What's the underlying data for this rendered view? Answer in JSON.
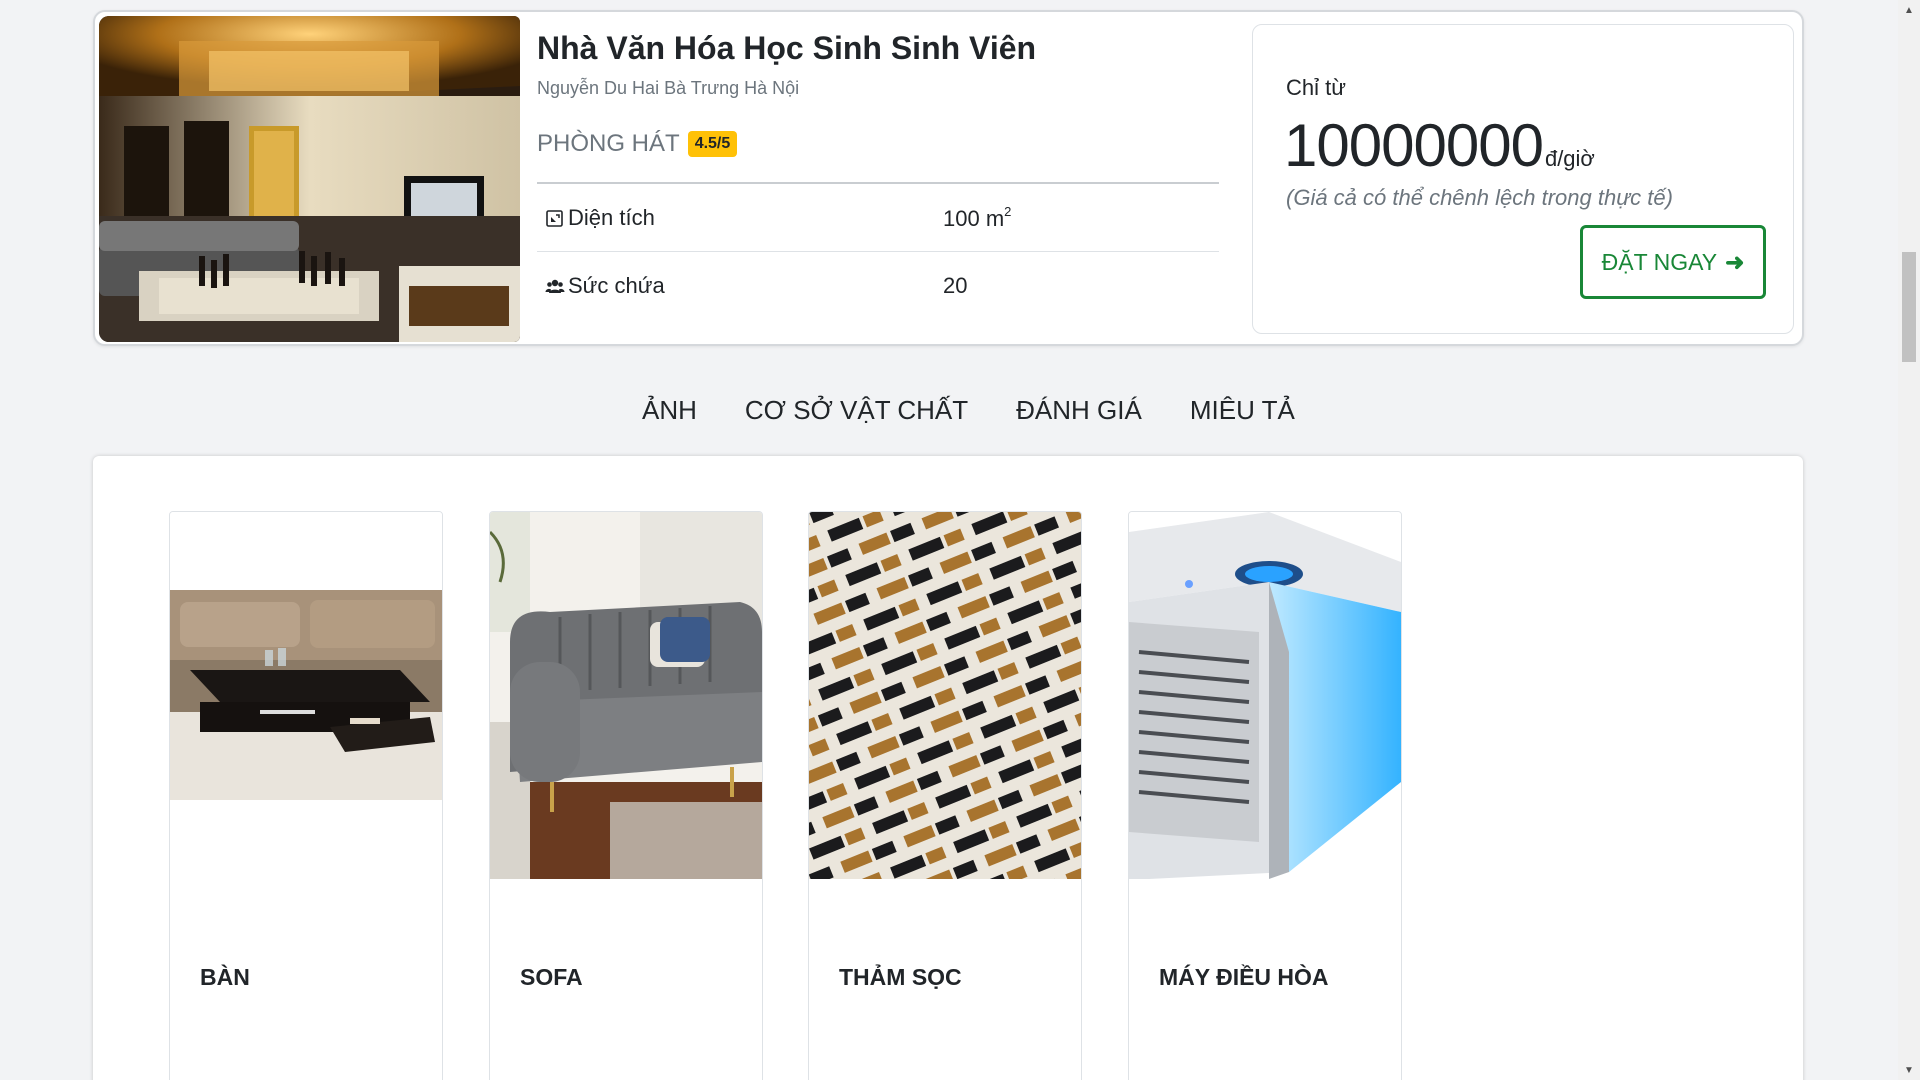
{
  "room": {
    "title": "Nhà Văn Hóa Học Sinh Sinh Viên",
    "address": "Nguyễn Du Hai Bà Trưng Hà Nội",
    "type": "PHÒNG HÁT",
    "rating": "4.5/5",
    "specs": {
      "area_label": "Diện tích",
      "area_value": "100 m",
      "area_unit_sup": "2",
      "capacity_label": "Sức chứa",
      "capacity_value": "20"
    },
    "photo_icon": "karaoke-room-photo"
  },
  "price": {
    "from_label": "Chỉ từ",
    "amount": "10000000",
    "unit": "đ/giờ",
    "note": "(Giá cả có thể chênh lệch trong thực tế)",
    "book_label": "ĐẶT NGAY",
    "book_arrow": "➜",
    "accent_color": "#198737"
  },
  "tabs": [
    {
      "label": "ẢNH"
    },
    {
      "label": "CƠ SỞ VẬT CHẤT"
    },
    {
      "label": "ĐÁNH GIÁ"
    },
    {
      "label": "MIÊU TẢ"
    }
  ],
  "facilities": [
    {
      "name": "BÀN",
      "icon": "coffee-table-photo"
    },
    {
      "name": "SOFA",
      "icon": "sofa-photo"
    },
    {
      "name": "THẢM SỌC",
      "icon": "striped-rug-photo"
    },
    {
      "name": "MÁY ĐIỀU HÒA",
      "icon": "air-cooler-photo"
    }
  ],
  "colors": {
    "badge": "#ffc107",
    "muted_text": "#6c757d",
    "background": "#f2f3f5"
  }
}
